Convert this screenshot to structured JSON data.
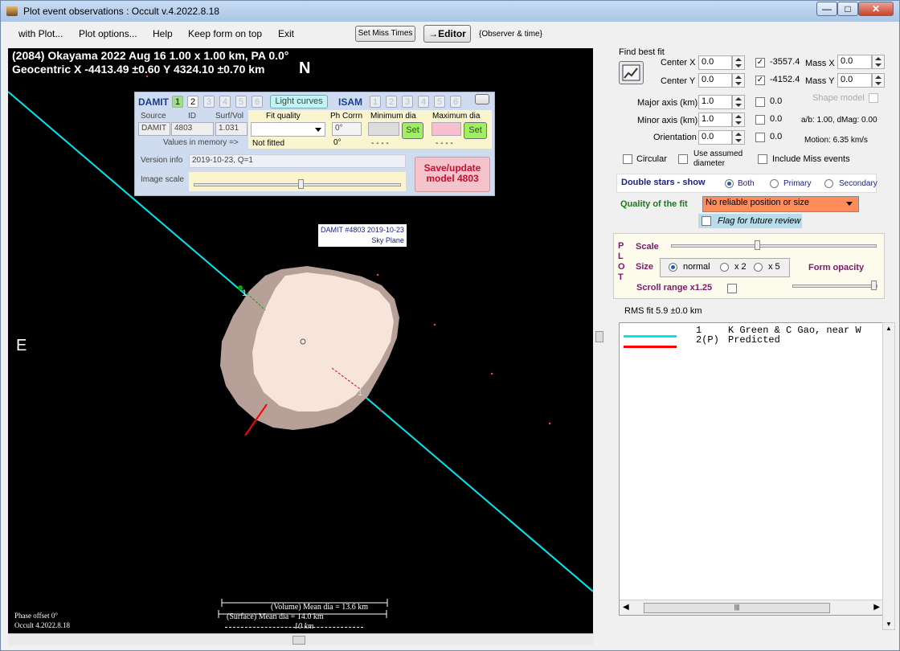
{
  "window": {
    "title": "Plot event observations : Occult v.4.2022.8.18"
  },
  "menu": {
    "with_plot": "with Plot...",
    "plot_options": "Plot options...",
    "help": "Help",
    "keep_on_top": "Keep form on top",
    "exit": "Exit"
  },
  "toolbar": {
    "set_miss_times": "Set Miss Times",
    "editor": "→Editor",
    "observer_time": "{Observer & time}"
  },
  "plot": {
    "line1": "(2084) Okayama  2022 Aug 16   1.00 x 1.00 km, PA 0.0°",
    "line2": "Geocentric  X  -4413.49 ±0.60  Y 4324.10 ±0.70 km",
    "north": "N",
    "east": "E",
    "model_label": "DAMIT #4803 2019-10-23",
    "sky_plane": "Sky Plane",
    "chord1_a": "1",
    "chord1_b": "1",
    "phase_offset": "Phase offset 0°",
    "occult_version": "Occult 4.2022.8.18",
    "vol_dia": "(Volume) Mean dia = 13.6 km",
    "surf_dia": "(Surface) Mean dia = 14.0 km",
    "scale_bar": "10 km"
  },
  "damit": {
    "title": "DAMIT",
    "buttons": [
      "1",
      "2",
      "3",
      "4",
      "5",
      "6"
    ],
    "light_curves": "Light curves",
    "isam": "ISAM",
    "isam_buttons": [
      "1",
      "2",
      "3",
      "4",
      "5",
      "6"
    ],
    "h_source": "Source",
    "h_id": "ID",
    "h_surfvol": "Surf/Vol",
    "h_fit": "Fit quality",
    "h_phcorr": "Ph Corrn",
    "h_mindia": "Minimum dia",
    "h_maxdia": "Maximum dia",
    "source": "DAMIT",
    "id": "4803",
    "surfvol": "1.031",
    "phcorr": "0°",
    "set": "Set",
    "values_mem": "Values in memory =>",
    "not_fitted": "Not fitted",
    "mem_ph": "0°",
    "mem_min": "- - - -",
    "mem_max": "- - - -",
    "version_label": "Version info",
    "version": "2019-10-23, Q=1",
    "image_scale": "Image scale",
    "save_update": "Save/update model 4803"
  },
  "fit": {
    "find_best_fit": "Find best fit",
    "center_x_label": "Center X",
    "center_x": "0.0",
    "center_y_label": "Center Y",
    "center_y": "0.0",
    "cx_val": "-3557.4",
    "cy_val": "-4152.4",
    "mass_x_label": "Mass X",
    "mass_x": "0.0",
    "mass_y_label": "Mass Y",
    "mass_y": "0.0",
    "major_label": "Major axis (km)",
    "major": "1.0",
    "major_val": "0.0",
    "minor_label": "Minor axis (km)",
    "minor": "1.0",
    "minor_val": "0.0",
    "orient_label": "Orientation",
    "orient": "0.0",
    "orient_val": "0.0",
    "shape_model": "Shape model",
    "ab_dmag": "a/b: 1.00, dMag: 0.00",
    "motion": "Motion: 6.35 km/s",
    "circular": "Circular",
    "use_assumed": "Use assumed diameter",
    "include_miss": "Include Miss events",
    "double_stars": "Double stars - show",
    "both": "Both",
    "primary": "Primary",
    "secondary": "Secondary",
    "quality_label": "Quality of the fit",
    "quality": "No reliable position or size",
    "flag_review": "Flag for future review"
  },
  "plotpanel": {
    "plot_letters": [
      "P",
      "L",
      "O",
      "T"
    ],
    "scale": "Scale",
    "size": "Size",
    "normal": "normal",
    "x2": "x 2",
    "x5": "x 5",
    "form_opacity": "Form opacity",
    "scroll_range": "Scroll range x1.25"
  },
  "rms": "RMS fit 5.9 ±0.0 km",
  "legend": [
    {
      "num": "1",
      "text": "K Green & C Gao, near W",
      "color": "#00e5ee"
    },
    {
      "num": "2(P)",
      "text": "Predicted",
      "color": "#ff0000"
    }
  ],
  "colors": {
    "chord": "#00e5ee",
    "predicted": "#ff0000",
    "quality_bg": "#ff8c5a"
  }
}
